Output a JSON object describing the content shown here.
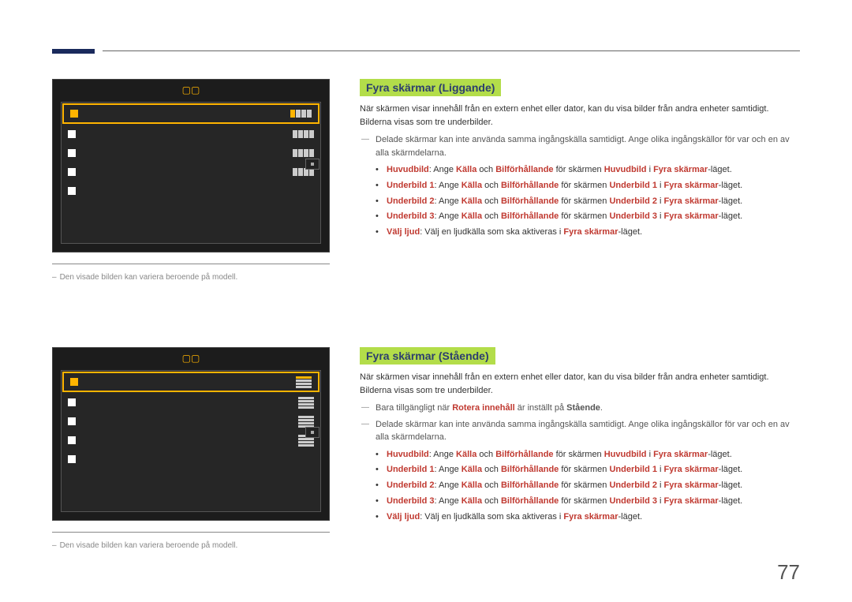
{
  "page_number": "77",
  "section1": {
    "heading": "Fyra skärmar (Liggande)",
    "intro": "När skärmen visar innehåll från en extern enhet eller dator, kan du visa bilder från andra enheter samtidigt. Bilderna visas som tre underbilder.",
    "note1": "Delade skärmar kan inte använda samma ingångskälla samtidigt. Ange olika ingångskällor för var och en av alla skärmdelarna.",
    "bullets": {
      "b1_k": "Huvudbild",
      "b1_t1": ": Ange ",
      "b1_k2": "Källa",
      "b1_t2": " och ",
      "b1_k3": "Bilförhållande",
      "b1_t3": " för skärmen ",
      "b1_k4": "Huvudbild",
      "b1_t4": " i ",
      "b1_k5": "Fyra skärmar",
      "b1_t5": "-läget.",
      "b2_k": "Underbild 1",
      "b2_t1": ": Ange ",
      "b2_k2": "Källa",
      "b2_t2": " och ",
      "b2_k3": "Bilförhållande",
      "b2_t3": " för skärmen ",
      "b2_k4": "Underbild 1",
      "b2_t4": " i ",
      "b2_k5": "Fyra skärmar",
      "b2_t5": "-läget.",
      "b3_k": "Underbild 2",
      "b3_t1": ": Ange ",
      "b3_k2": "Källa",
      "b3_t2": " och ",
      "b3_k3": "Bilförhållande",
      "b3_t3": " för skärmen ",
      "b3_k4": "Underbild 2",
      "b3_t4": " i ",
      "b3_k5": "Fyra skärmar",
      "b3_t5": "-läget.",
      "b4_k": "Underbild 3",
      "b4_t1": ": Ange ",
      "b4_k2": "Källa",
      "b4_t2": " och ",
      "b4_k3": "Bilförhållande",
      "b4_t3": " för skärmen ",
      "b4_k4": "Underbild 3",
      "b4_t4": " i ",
      "b4_k5": "Fyra skärmar",
      "b4_t5": "-läget.",
      "b5_k": "Välj ljud",
      "b5_t1": ": Välj en ljudkälla som ska aktiveras i ",
      "b5_k2": "Fyra skärmar",
      "b5_t2": "-läget."
    },
    "caption": "Den visade bilden kan variera beroende på modell."
  },
  "section2": {
    "heading": "Fyra skärmar (Stående)",
    "intro": "När skärmen visar innehåll från en extern enhet eller dator, kan du visa bilder från andra enheter samtidigt. Bilderna visas som tre underbilder.",
    "note0a": "Bara tillgängligt när ",
    "note0b": "Rotera innehåll",
    "note0c": " är inställt på ",
    "note0d": "Stående",
    "note0e": ".",
    "note1": "Delade skärmar kan inte använda samma ingångskälla samtidigt. Ange olika ingångskällor för var och en av alla skärmdelarna.",
    "bullets": {
      "b1_k": "Huvudbild",
      "b1_t1": ": Ange ",
      "b1_k2": "Källa",
      "b1_t2": " och ",
      "b1_k3": "Bilförhållande",
      "b1_t3": " för skärmen ",
      "b1_k4": "Huvudbild",
      "b1_t4": " i ",
      "b1_k5": "Fyra skärmar",
      "b1_t5": "-läget.",
      "b2_k": "Underbild 1",
      "b2_t1": ": Ange ",
      "b2_k2": "Källa",
      "b2_t2": " och ",
      "b2_k3": "Bilförhållande",
      "b2_t3": " för skärmen ",
      "b2_k4": "Underbild 1",
      "b2_t4": " i ",
      "b2_k5": "Fyra skärmar",
      "b2_t5": "-läget.",
      "b3_k": "Underbild 2",
      "b3_t1": ": Ange ",
      "b3_k2": "Källa",
      "b3_t2": " och ",
      "b3_k3": "Bilförhållande",
      "b3_t3": " för skärmen ",
      "b3_k4": "Underbild 2",
      "b3_t4": " i ",
      "b3_k5": "Fyra skärmar",
      "b3_t5": "-läget.",
      "b4_k": "Underbild 3",
      "b4_t1": ": Ange ",
      "b4_k2": "Källa",
      "b4_t2": " och ",
      "b4_k3": "Bilförhållande",
      "b4_t3": " för skärmen ",
      "b4_k4": "Underbild 3",
      "b4_t4": " i ",
      "b4_k5": "Fyra skärmar",
      "b4_t5": "-läget.",
      "b5_k": "Välj ljud",
      "b5_t1": ": Välj en ljudkälla som ska aktiveras i ",
      "b5_k2": "Fyra skärmar",
      "b5_t2": "-läget."
    },
    "caption": "Den visade bilden kan variera beroende på modell."
  },
  "ui": {
    "title": "·"
  }
}
